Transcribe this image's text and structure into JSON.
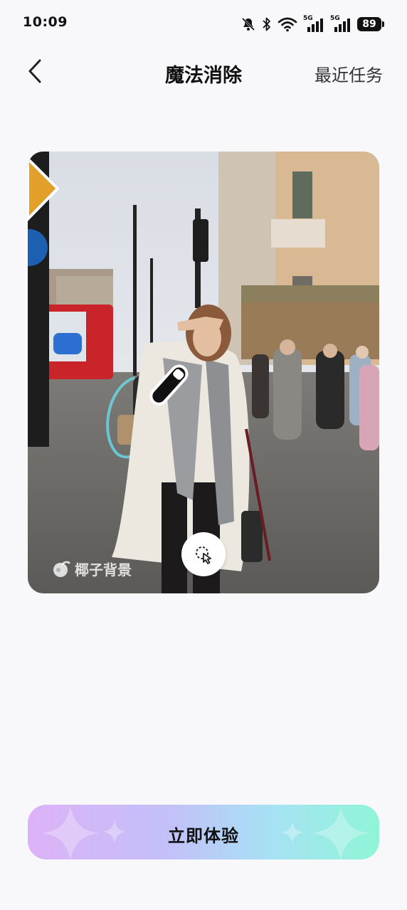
{
  "status_bar": {
    "time": "10:09",
    "network_tag_1": "5G",
    "network_tag_2": "5G",
    "battery": "89",
    "icons": [
      "mute-bell-icon",
      "bluetooth-icon",
      "wifi-icon",
      "signal-icon",
      "signal-icon",
      "battery-icon"
    ]
  },
  "header": {
    "title": "魔法消除",
    "recent_tasks": "最近任务",
    "back_icon": "chevron-left-icon"
  },
  "preview": {
    "watermark": "椰子背景",
    "magic_button_icon": "magic-select-icon",
    "brush_icon": "brush-icon"
  },
  "cta": {
    "label": "立即体验",
    "gradient": [
      "#dcb2f6",
      "#c3c0f8",
      "#a6e2f4",
      "#8ff5d6"
    ]
  }
}
